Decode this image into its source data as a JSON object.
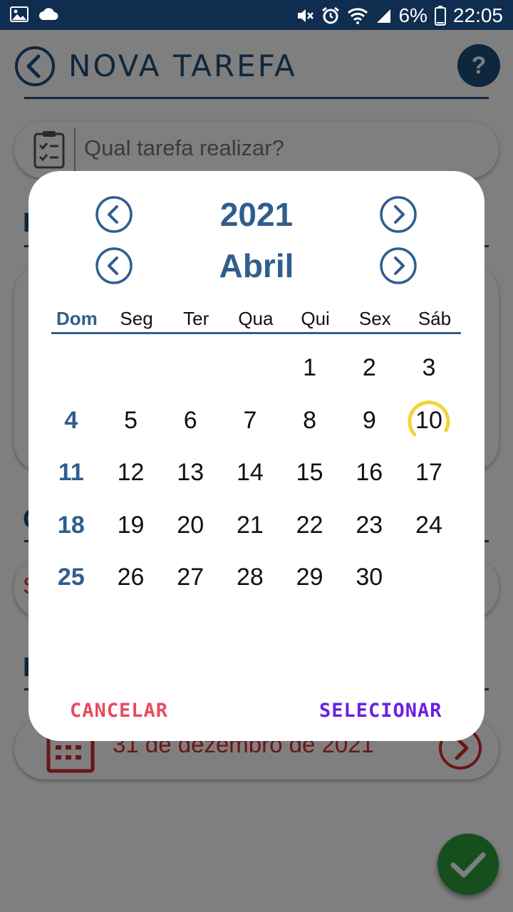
{
  "status_bar": {
    "battery": "6%",
    "time": "22:05"
  },
  "app": {
    "title": "NOVA TAREFA",
    "help_label": "?",
    "task_placeholder": "Qual tarefa realizar?",
    "date_value": "31 de dezembro de 2021"
  },
  "calendar": {
    "year": "2021",
    "month": "Abril",
    "weekdays": [
      "Dom",
      "Seg",
      "Ter",
      "Qua",
      "Qui",
      "Sex",
      "Sáb"
    ],
    "weeks": [
      [
        "",
        "",
        "",
        "",
        "1",
        "2",
        "3"
      ],
      [
        "4",
        "5",
        "6",
        "7",
        "8",
        "9",
        "10"
      ],
      [
        "11",
        "12",
        "13",
        "14",
        "15",
        "16",
        "17"
      ],
      [
        "18",
        "19",
        "20",
        "21",
        "22",
        "23",
        "24"
      ],
      [
        "25",
        "26",
        "27",
        "28",
        "29",
        "30",
        ""
      ]
    ],
    "highlighted_day": "10",
    "cancel_label": "CANCELAR",
    "select_label": "SELECIONAR"
  },
  "colors": {
    "primary": "#2f5e8e",
    "cancel": "#e84a5f",
    "select": "#6a1ee8",
    "highlight_ring": "#f2d43a",
    "fab": "#2e9c3c"
  }
}
